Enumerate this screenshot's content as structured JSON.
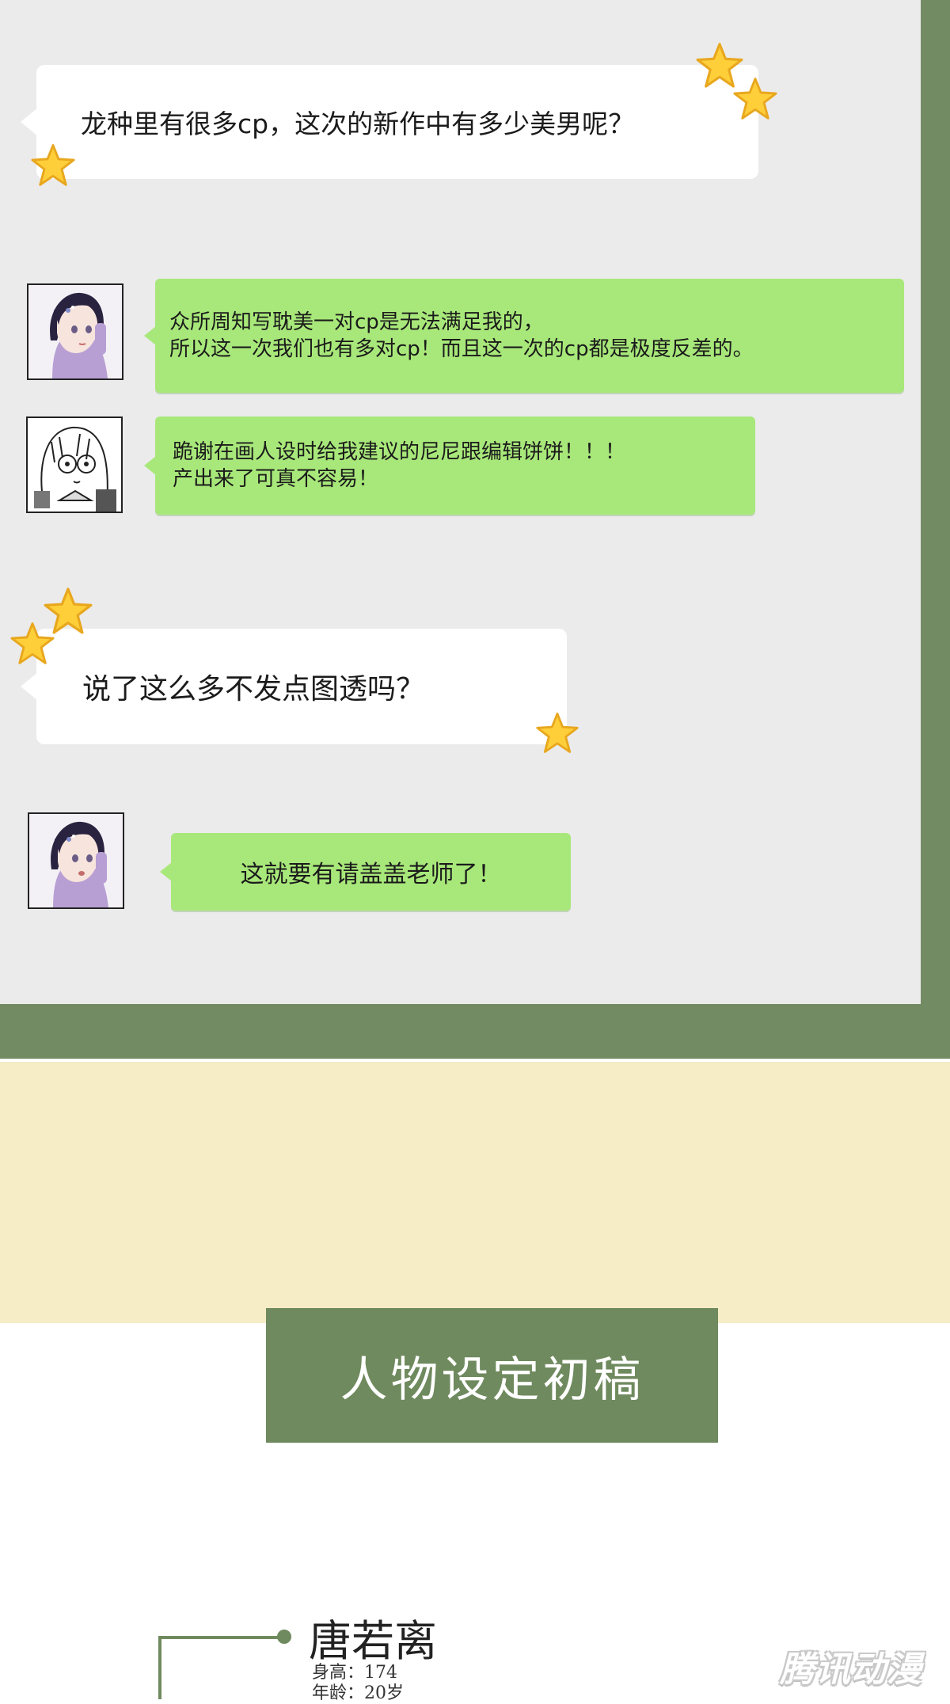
{
  "chat": {
    "q1": "龙种里有很多cp，这次的新作中有多少美男呢？",
    "a1": "众所周知写耽美一对cp是无法满足我的，\n所以这一次我们也有多对cp！而且这一次的cp都是极度反差的。",
    "a2": "跪谢在画人设时给我建议的尼尼跟编辑饼饼！！！\n产出来了可真不容易！",
    "q2": "说了这么多不发点图透吗？",
    "a3": "这就要有请盖盖老师了！"
  },
  "section": {
    "title": "人物设定初稿"
  },
  "character": {
    "name": "唐若离",
    "height": "身高：174",
    "age": "年龄：20岁"
  },
  "watermark": "腾讯动漫",
  "colors": {
    "panel_bg": "#ebebeb",
    "frame_green": "#738b63",
    "bubble_green": "#a8e87a",
    "beige": "#f6ecc5",
    "title_green": "#6f8a5e",
    "star_yellow": "#ffcf3a"
  }
}
